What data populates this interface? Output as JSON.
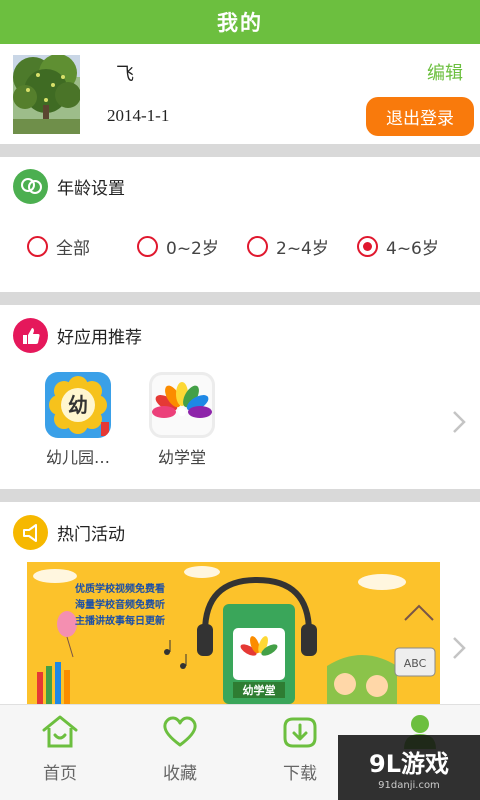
{
  "header": {
    "title": "我的"
  },
  "profile": {
    "username": "飞",
    "date": "2014-1-1",
    "edit_label": "编辑",
    "logout_label": "退出登录"
  },
  "age_section": {
    "title": "年龄设置",
    "options": [
      {
        "label": "全部",
        "selected": false
      },
      {
        "label": "0~2岁",
        "selected": false
      },
      {
        "label": "2~4岁",
        "selected": false
      },
      {
        "label": "4~6岁",
        "selected": true
      }
    ]
  },
  "apps_section": {
    "title": "好应用推荐",
    "apps": [
      {
        "label": "幼儿园…",
        "icon_text": "幼"
      },
      {
        "label": "幼学堂"
      }
    ]
  },
  "activity_section": {
    "title": "热门活动",
    "banner": {
      "lines": [
        "优质学校视频免费看",
        "海量学校音频免费听",
        "主播讲故事每日更新"
      ],
      "app_name": "幼学堂",
      "abc": "ABC"
    }
  },
  "tabbar": {
    "tabs": [
      {
        "label": "首页",
        "icon": "home-icon"
      },
      {
        "label": "收藏",
        "icon": "heart-icon"
      },
      {
        "label": "下载",
        "icon": "download-icon"
      },
      {
        "label": "",
        "icon": "user-icon"
      }
    ]
  },
  "watermark": {
    "main": "9L游戏",
    "sub": "91danji.com"
  },
  "colors": {
    "brand_green": "#6cbf3f",
    "logout_orange": "#f97a0c",
    "radio_red": "#e0182e",
    "age_icon_green": "#4caf50",
    "apps_icon_pink": "#e5185b",
    "activity_icon_yellow": "#f6b800",
    "banner_yellow": "#fcc22b"
  }
}
